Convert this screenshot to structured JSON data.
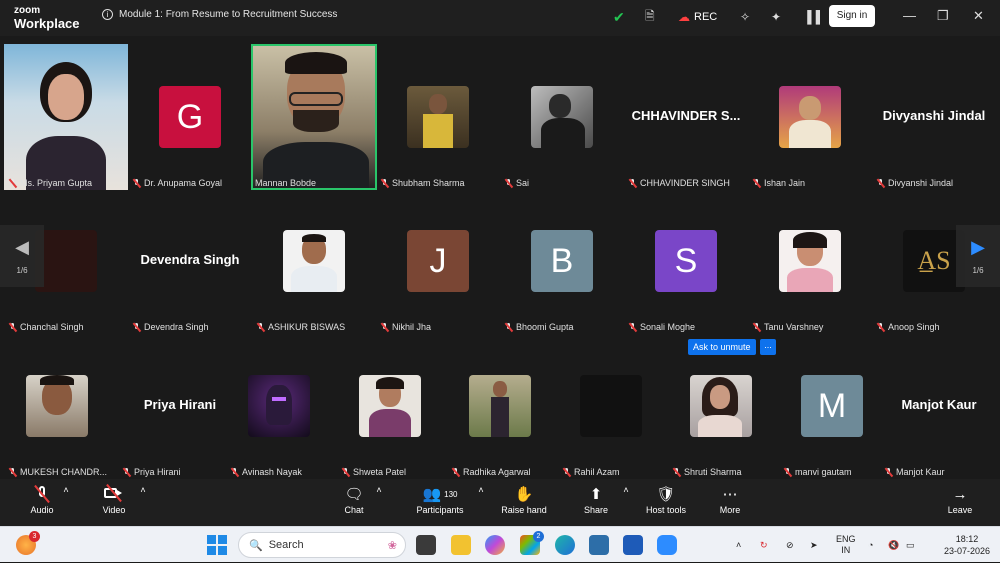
{
  "titlebar": {
    "logo_top": "zoom",
    "logo_bottom": "Workplace",
    "meeting_title": "Module 1: From Resume to Recruitment Success",
    "rec_label": "REC",
    "signin_label": "Sign in"
  },
  "gallery": {
    "row1": [
      {
        "name": "Ms. Priyam Gupta",
        "type": "video"
      },
      {
        "name": "Dr. Anupama Goyal",
        "type": "letter",
        "letter": "G",
        "color": "#c8103e"
      },
      {
        "name": "Mannan Bobde",
        "type": "video",
        "active": true
      },
      {
        "name": "Shubham Sharma",
        "type": "photo"
      },
      {
        "name": "Sai",
        "type": "photo"
      },
      {
        "name": "CHHAVINDER SINGH",
        "type": "text",
        "display": "CHHAVINDER  S..."
      },
      {
        "name": "Ishan Jain",
        "type": "photo"
      },
      {
        "name": "Divyanshi Jindal",
        "type": "text",
        "display": "Divyanshi Jindal"
      }
    ],
    "row2": [
      {
        "name": "Chanchal Singh",
        "type": "photo"
      },
      {
        "name": "Devendra Singh",
        "type": "text",
        "display": "Devendra Singh"
      },
      {
        "name": "ASHIKUR BISWAS",
        "type": "photo"
      },
      {
        "name": "Nikhil Jha",
        "type": "letter",
        "letter": "J",
        "color": "#7a4634"
      },
      {
        "name": "Bhoomi Gupta",
        "type": "letter",
        "letter": "B",
        "color": "#6e8a98"
      },
      {
        "name": "Sonali Moghe",
        "type": "letter",
        "letter": "S",
        "color": "#7a46c8"
      },
      {
        "name": "Tanu Varshney",
        "type": "photo"
      },
      {
        "name": "Anoop Singh",
        "type": "photo"
      }
    ],
    "row3": [
      {
        "name": "MUKESH CHANDR...",
        "type": "photo"
      },
      {
        "name": "Priya Hirani",
        "type": "text",
        "display": "Priya Hirani"
      },
      {
        "name": "Avinash Nayak",
        "type": "photo"
      },
      {
        "name": "Shweta Patel",
        "type": "photo"
      },
      {
        "name": "Radhika Agarwal",
        "type": "photo"
      },
      {
        "name": "Rahil Azam",
        "type": "photo"
      },
      {
        "name": "Shruti Sharma",
        "type": "photo"
      },
      {
        "name": "manvi gautam",
        "type": "letter",
        "letter": "M",
        "color": "#6e8a98"
      },
      {
        "name": "Manjot Kaur",
        "type": "text",
        "display": "Manjot Kaur"
      }
    ],
    "page_left": "1/6",
    "page_right": "1/6",
    "ask_unmute": "Ask to unmute",
    "more": "..."
  },
  "toolbar": {
    "audio": "Audio",
    "video": "Video",
    "chat": "Chat",
    "participants": "Participants",
    "participants_count": "130",
    "raise_hand": "Raise hand",
    "share": "Share",
    "host_tools": "Host tools",
    "more": "More",
    "leave": "Leave"
  },
  "taskbar": {
    "search_label": "Search",
    "notif_badge": "3",
    "app_badge": "2",
    "lang_top": "ENG",
    "lang_bottom": "IN",
    "time": "18:12",
    "date": "23-07-2026"
  }
}
